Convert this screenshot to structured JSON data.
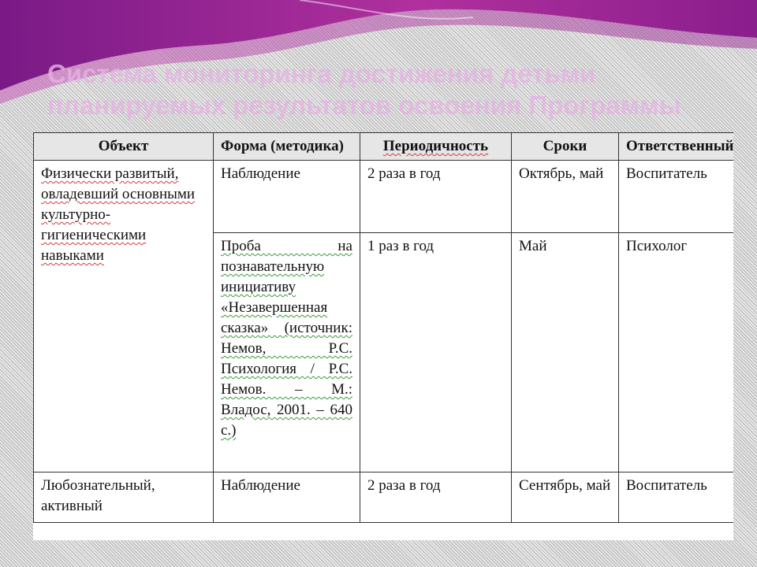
{
  "slide": {
    "title": "Система мониторинга достижения детьми планируемых результатов освоения Программы"
  },
  "table": {
    "headers": {
      "object": "Объект",
      "form": "Форма (методика)",
      "period": "Периодичность",
      "dates": "Сроки",
      "responsible": "Ответственный"
    },
    "rows": [
      {
        "object": "Физически развитый, овладевший основными культурно-гигиеническими навыками",
        "form": "Наблюдение",
        "period": "2 раза в год",
        "dates": "Октябрь, май",
        "responsible": "Воспитатель"
      },
      {
        "form": "Проба на познавательную инициативу «Незавершенная сказка» (источник: Немов, Р.С. Психология / Р.С. Немов. – М.: Владос, 2001. – 640 с.)",
        "period": "1 раз в год",
        "dates": "Май",
        "responsible": "Психолог"
      },
      {
        "object": "Любознательный, активный",
        "form": "Наблюдение",
        "period": "2 раза в год",
        "dates": "Сентябрь, май",
        "responsible": "Воспитатель"
      }
    ]
  },
  "colors": {
    "banner_dark": "#7a1a86",
    "banner_light": "#c13aa8",
    "title_text": "#e6b3e3",
    "border": "#333333",
    "spellcheck_underline": "#d23b3b"
  }
}
